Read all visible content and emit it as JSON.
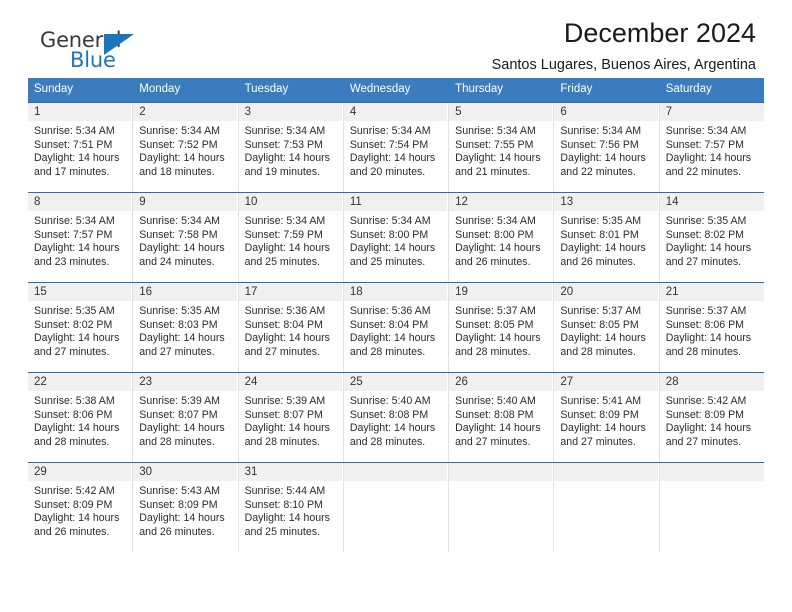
{
  "brand": {
    "name_top": "General",
    "name_bottom": "Blue",
    "accent_color": "#1b75bb"
  },
  "header": {
    "title": "December 2024",
    "location": "Santos Lugares, Buenos Aires, Argentina"
  },
  "calendar": {
    "header_bg": "#3b7cbf",
    "daynum_bg": "#f0f0f0",
    "weekdays": [
      "Sunday",
      "Monday",
      "Tuesday",
      "Wednesday",
      "Thursday",
      "Friday",
      "Saturday"
    ],
    "weeks": [
      [
        {
          "day": "1",
          "sunrise": "Sunrise: 5:34 AM",
          "sunset": "Sunset: 7:51 PM",
          "daylight1": "Daylight: 14 hours",
          "daylight2": "and 17 minutes."
        },
        {
          "day": "2",
          "sunrise": "Sunrise: 5:34 AM",
          "sunset": "Sunset: 7:52 PM",
          "daylight1": "Daylight: 14 hours",
          "daylight2": "and 18 minutes."
        },
        {
          "day": "3",
          "sunrise": "Sunrise: 5:34 AM",
          "sunset": "Sunset: 7:53 PM",
          "daylight1": "Daylight: 14 hours",
          "daylight2": "and 19 minutes."
        },
        {
          "day": "4",
          "sunrise": "Sunrise: 5:34 AM",
          "sunset": "Sunset: 7:54 PM",
          "daylight1": "Daylight: 14 hours",
          "daylight2": "and 20 minutes."
        },
        {
          "day": "5",
          "sunrise": "Sunrise: 5:34 AM",
          "sunset": "Sunset: 7:55 PM",
          "daylight1": "Daylight: 14 hours",
          "daylight2": "and 21 minutes."
        },
        {
          "day": "6",
          "sunrise": "Sunrise: 5:34 AM",
          "sunset": "Sunset: 7:56 PM",
          "daylight1": "Daylight: 14 hours",
          "daylight2": "and 22 minutes."
        },
        {
          "day": "7",
          "sunrise": "Sunrise: 5:34 AM",
          "sunset": "Sunset: 7:57 PM",
          "daylight1": "Daylight: 14 hours",
          "daylight2": "and 22 minutes."
        }
      ],
      [
        {
          "day": "8",
          "sunrise": "Sunrise: 5:34 AM",
          "sunset": "Sunset: 7:57 PM",
          "daylight1": "Daylight: 14 hours",
          "daylight2": "and 23 minutes."
        },
        {
          "day": "9",
          "sunrise": "Sunrise: 5:34 AM",
          "sunset": "Sunset: 7:58 PM",
          "daylight1": "Daylight: 14 hours",
          "daylight2": "and 24 minutes."
        },
        {
          "day": "10",
          "sunrise": "Sunrise: 5:34 AM",
          "sunset": "Sunset: 7:59 PM",
          "daylight1": "Daylight: 14 hours",
          "daylight2": "and 25 minutes."
        },
        {
          "day": "11",
          "sunrise": "Sunrise: 5:34 AM",
          "sunset": "Sunset: 8:00 PM",
          "daylight1": "Daylight: 14 hours",
          "daylight2": "and 25 minutes."
        },
        {
          "day": "12",
          "sunrise": "Sunrise: 5:34 AM",
          "sunset": "Sunset: 8:00 PM",
          "daylight1": "Daylight: 14 hours",
          "daylight2": "and 26 minutes."
        },
        {
          "day": "13",
          "sunrise": "Sunrise: 5:35 AM",
          "sunset": "Sunset: 8:01 PM",
          "daylight1": "Daylight: 14 hours",
          "daylight2": "and 26 minutes."
        },
        {
          "day": "14",
          "sunrise": "Sunrise: 5:35 AM",
          "sunset": "Sunset: 8:02 PM",
          "daylight1": "Daylight: 14 hours",
          "daylight2": "and 27 minutes."
        }
      ],
      [
        {
          "day": "15",
          "sunrise": "Sunrise: 5:35 AM",
          "sunset": "Sunset: 8:02 PM",
          "daylight1": "Daylight: 14 hours",
          "daylight2": "and 27 minutes."
        },
        {
          "day": "16",
          "sunrise": "Sunrise: 5:35 AM",
          "sunset": "Sunset: 8:03 PM",
          "daylight1": "Daylight: 14 hours",
          "daylight2": "and 27 minutes."
        },
        {
          "day": "17",
          "sunrise": "Sunrise: 5:36 AM",
          "sunset": "Sunset: 8:04 PM",
          "daylight1": "Daylight: 14 hours",
          "daylight2": "and 27 minutes."
        },
        {
          "day": "18",
          "sunrise": "Sunrise: 5:36 AM",
          "sunset": "Sunset: 8:04 PM",
          "daylight1": "Daylight: 14 hours",
          "daylight2": "and 28 minutes."
        },
        {
          "day": "19",
          "sunrise": "Sunrise: 5:37 AM",
          "sunset": "Sunset: 8:05 PM",
          "daylight1": "Daylight: 14 hours",
          "daylight2": "and 28 minutes."
        },
        {
          "day": "20",
          "sunrise": "Sunrise: 5:37 AM",
          "sunset": "Sunset: 8:05 PM",
          "daylight1": "Daylight: 14 hours",
          "daylight2": "and 28 minutes."
        },
        {
          "day": "21",
          "sunrise": "Sunrise: 5:37 AM",
          "sunset": "Sunset: 8:06 PM",
          "daylight1": "Daylight: 14 hours",
          "daylight2": "and 28 minutes."
        }
      ],
      [
        {
          "day": "22",
          "sunrise": "Sunrise: 5:38 AM",
          "sunset": "Sunset: 8:06 PM",
          "daylight1": "Daylight: 14 hours",
          "daylight2": "and 28 minutes."
        },
        {
          "day": "23",
          "sunrise": "Sunrise: 5:39 AM",
          "sunset": "Sunset: 8:07 PM",
          "daylight1": "Daylight: 14 hours",
          "daylight2": "and 28 minutes."
        },
        {
          "day": "24",
          "sunrise": "Sunrise: 5:39 AM",
          "sunset": "Sunset: 8:07 PM",
          "daylight1": "Daylight: 14 hours",
          "daylight2": "and 28 minutes."
        },
        {
          "day": "25",
          "sunrise": "Sunrise: 5:40 AM",
          "sunset": "Sunset: 8:08 PM",
          "daylight1": "Daylight: 14 hours",
          "daylight2": "and 28 minutes."
        },
        {
          "day": "26",
          "sunrise": "Sunrise: 5:40 AM",
          "sunset": "Sunset: 8:08 PM",
          "daylight1": "Daylight: 14 hours",
          "daylight2": "and 27 minutes."
        },
        {
          "day": "27",
          "sunrise": "Sunrise: 5:41 AM",
          "sunset": "Sunset: 8:09 PM",
          "daylight1": "Daylight: 14 hours",
          "daylight2": "and 27 minutes."
        },
        {
          "day": "28",
          "sunrise": "Sunrise: 5:42 AM",
          "sunset": "Sunset: 8:09 PM",
          "daylight1": "Daylight: 14 hours",
          "daylight2": "and 27 minutes."
        }
      ],
      [
        {
          "day": "29",
          "sunrise": "Sunrise: 5:42 AM",
          "sunset": "Sunset: 8:09 PM",
          "daylight1": "Daylight: 14 hours",
          "daylight2": "and 26 minutes."
        },
        {
          "day": "30",
          "sunrise": "Sunrise: 5:43 AM",
          "sunset": "Sunset: 8:09 PM",
          "daylight1": "Daylight: 14 hours",
          "daylight2": "and 26 minutes."
        },
        {
          "day": "31",
          "sunrise": "Sunrise: 5:44 AM",
          "sunset": "Sunset: 8:10 PM",
          "daylight1": "Daylight: 14 hours",
          "daylight2": "and 25 minutes."
        },
        {
          "day": "",
          "sunrise": "",
          "sunset": "",
          "daylight1": "",
          "daylight2": ""
        },
        {
          "day": "",
          "sunrise": "",
          "sunset": "",
          "daylight1": "",
          "daylight2": ""
        },
        {
          "day": "",
          "sunrise": "",
          "sunset": "",
          "daylight1": "",
          "daylight2": ""
        },
        {
          "day": "",
          "sunrise": "",
          "sunset": "",
          "daylight1": "",
          "daylight2": ""
        }
      ]
    ]
  }
}
